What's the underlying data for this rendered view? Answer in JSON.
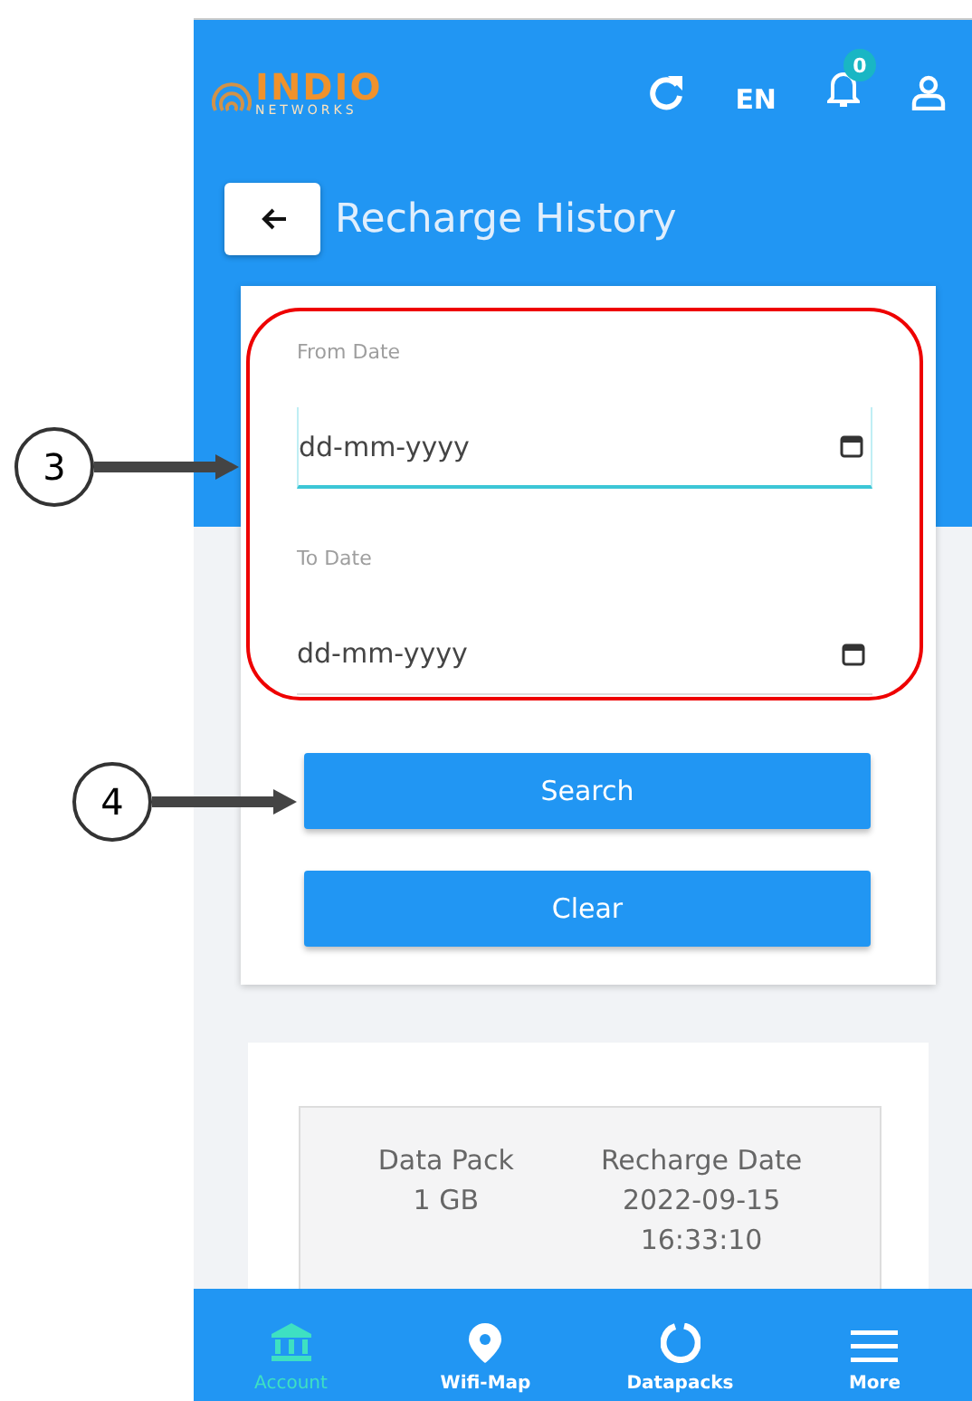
{
  "header": {
    "logo": {
      "name": "INDIO",
      "tagline": "NETWORKS"
    },
    "language": "EN",
    "notifications": {
      "count": "0"
    }
  },
  "page": {
    "title": "Recharge History"
  },
  "filter": {
    "fields": [
      {
        "label": "From Date",
        "placeholder": "dd-mm-yyyy",
        "focused": true
      },
      {
        "label": "To Date",
        "placeholder": "dd-mm-yyyy",
        "focused": false
      }
    ],
    "buttons": [
      "Search",
      "Clear"
    ]
  },
  "history": {
    "columns": [
      {
        "heading": "Data Pack",
        "lines": [
          "1 GB"
        ]
      },
      {
        "heading": "Recharge Date",
        "lines": [
          "2022-09-15",
          "16:33:10"
        ]
      }
    ]
  },
  "bottom_nav": [
    {
      "label": "Account",
      "selected": true
    },
    {
      "label": "Wifi-Map",
      "selected": false
    },
    {
      "label": "Datapacks",
      "selected": false
    },
    {
      "label": "More",
      "selected": false
    }
  ],
  "callouts": [
    {
      "number": "3"
    },
    {
      "number": "4"
    }
  ]
}
